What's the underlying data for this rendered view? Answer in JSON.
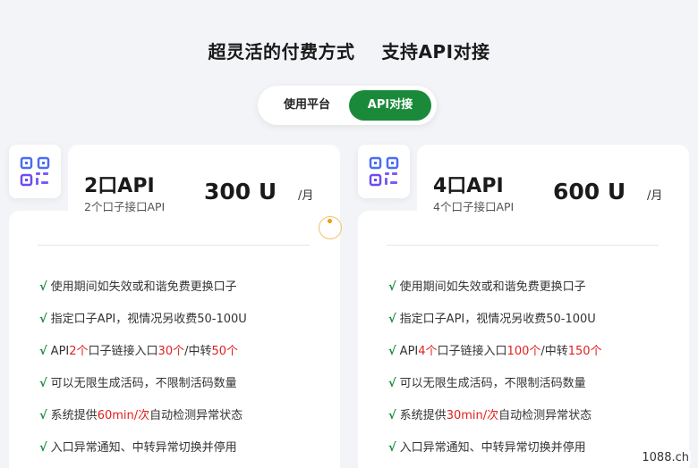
{
  "header": {
    "title_left": "超灵活的付费方式",
    "title_right": "支持API对接"
  },
  "toggle": {
    "option_platform": "使用平台",
    "option_api": "API对接",
    "selected": "API对接",
    "accent_color": "#1a8a3a"
  },
  "cards": [
    {
      "icon": "qr-code-icon",
      "name": "2口API",
      "description": "2个口子接口API",
      "price": "300 U",
      "unit": "/月",
      "features": [
        {
          "parts": [
            "使用期间如失效或和谐免费更换口子"
          ]
        },
        {
          "parts": [
            "指定口子API，视情况另收费50-100U"
          ]
        },
        {
          "parts": [
            "API",
            "2个",
            "口子链接入口",
            "30个",
            "/中转",
            "50个"
          ]
        },
        {
          "parts": [
            "可以无限生成活码，不限制活码数量"
          ]
        },
        {
          "parts": [
            "系统提供",
            "60min/次",
            "自动检测异常状态"
          ]
        },
        {
          "parts": [
            "入口异常通知、中转异常切换并停用"
          ]
        }
      ]
    },
    {
      "icon": "qr-code-icon",
      "name": "4口API",
      "description": "4个口子接口API",
      "price": "600 U",
      "unit": "/月",
      "features": [
        {
          "parts": [
            "使用期间如失效或和谐免费更换口子"
          ]
        },
        {
          "parts": [
            "指定口子API，视情况另收费50-100U"
          ]
        },
        {
          "parts": [
            "API",
            "4个",
            "口子链接入口",
            "100个",
            "/中转",
            "150个"
          ]
        },
        {
          "parts": [
            "可以无限生成活码，不限制活码数量"
          ]
        },
        {
          "parts": [
            "系统提供",
            "30min/次",
            "自动检测异常状态"
          ]
        },
        {
          "parts": [
            "入口异常通知、中转异常切换并停用"
          ]
        }
      ]
    }
  ],
  "check_mark": "√",
  "highlight_color": "#e02020",
  "watermark": "1088.ch"
}
